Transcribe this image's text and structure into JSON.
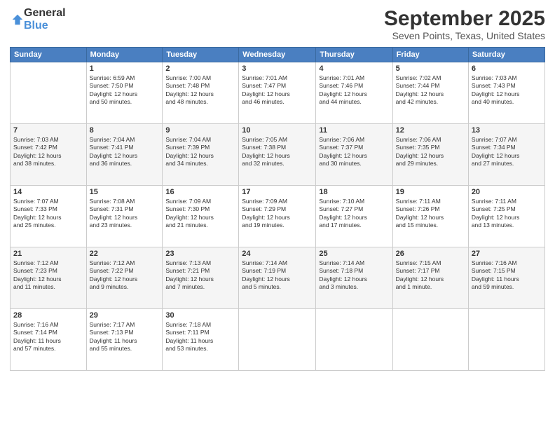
{
  "logo": {
    "general": "General",
    "blue": "Blue"
  },
  "title": "September 2025",
  "subtitle": "Seven Points, Texas, United States",
  "headers": [
    "Sunday",
    "Monday",
    "Tuesday",
    "Wednesday",
    "Thursday",
    "Friday",
    "Saturday"
  ],
  "weeks": [
    [
      {
        "day": "",
        "info": ""
      },
      {
        "day": "1",
        "info": "Sunrise: 6:59 AM\nSunset: 7:50 PM\nDaylight: 12 hours\nand 50 minutes."
      },
      {
        "day": "2",
        "info": "Sunrise: 7:00 AM\nSunset: 7:48 PM\nDaylight: 12 hours\nand 48 minutes."
      },
      {
        "day": "3",
        "info": "Sunrise: 7:01 AM\nSunset: 7:47 PM\nDaylight: 12 hours\nand 46 minutes."
      },
      {
        "day": "4",
        "info": "Sunrise: 7:01 AM\nSunset: 7:46 PM\nDaylight: 12 hours\nand 44 minutes."
      },
      {
        "day": "5",
        "info": "Sunrise: 7:02 AM\nSunset: 7:44 PM\nDaylight: 12 hours\nand 42 minutes."
      },
      {
        "day": "6",
        "info": "Sunrise: 7:03 AM\nSunset: 7:43 PM\nDaylight: 12 hours\nand 40 minutes."
      }
    ],
    [
      {
        "day": "7",
        "info": "Sunrise: 7:03 AM\nSunset: 7:42 PM\nDaylight: 12 hours\nand 38 minutes."
      },
      {
        "day": "8",
        "info": "Sunrise: 7:04 AM\nSunset: 7:41 PM\nDaylight: 12 hours\nand 36 minutes."
      },
      {
        "day": "9",
        "info": "Sunrise: 7:04 AM\nSunset: 7:39 PM\nDaylight: 12 hours\nand 34 minutes."
      },
      {
        "day": "10",
        "info": "Sunrise: 7:05 AM\nSunset: 7:38 PM\nDaylight: 12 hours\nand 32 minutes."
      },
      {
        "day": "11",
        "info": "Sunrise: 7:06 AM\nSunset: 7:37 PM\nDaylight: 12 hours\nand 30 minutes."
      },
      {
        "day": "12",
        "info": "Sunrise: 7:06 AM\nSunset: 7:35 PM\nDaylight: 12 hours\nand 29 minutes."
      },
      {
        "day": "13",
        "info": "Sunrise: 7:07 AM\nSunset: 7:34 PM\nDaylight: 12 hours\nand 27 minutes."
      }
    ],
    [
      {
        "day": "14",
        "info": "Sunrise: 7:07 AM\nSunset: 7:33 PM\nDaylight: 12 hours\nand 25 minutes."
      },
      {
        "day": "15",
        "info": "Sunrise: 7:08 AM\nSunset: 7:31 PM\nDaylight: 12 hours\nand 23 minutes."
      },
      {
        "day": "16",
        "info": "Sunrise: 7:09 AM\nSunset: 7:30 PM\nDaylight: 12 hours\nand 21 minutes."
      },
      {
        "day": "17",
        "info": "Sunrise: 7:09 AM\nSunset: 7:29 PM\nDaylight: 12 hours\nand 19 minutes."
      },
      {
        "day": "18",
        "info": "Sunrise: 7:10 AM\nSunset: 7:27 PM\nDaylight: 12 hours\nand 17 minutes."
      },
      {
        "day": "19",
        "info": "Sunrise: 7:11 AM\nSunset: 7:26 PM\nDaylight: 12 hours\nand 15 minutes."
      },
      {
        "day": "20",
        "info": "Sunrise: 7:11 AM\nSunset: 7:25 PM\nDaylight: 12 hours\nand 13 minutes."
      }
    ],
    [
      {
        "day": "21",
        "info": "Sunrise: 7:12 AM\nSunset: 7:23 PM\nDaylight: 12 hours\nand 11 minutes."
      },
      {
        "day": "22",
        "info": "Sunrise: 7:12 AM\nSunset: 7:22 PM\nDaylight: 12 hours\nand 9 minutes."
      },
      {
        "day": "23",
        "info": "Sunrise: 7:13 AM\nSunset: 7:21 PM\nDaylight: 12 hours\nand 7 minutes."
      },
      {
        "day": "24",
        "info": "Sunrise: 7:14 AM\nSunset: 7:19 PM\nDaylight: 12 hours\nand 5 minutes."
      },
      {
        "day": "25",
        "info": "Sunrise: 7:14 AM\nSunset: 7:18 PM\nDaylight: 12 hours\nand 3 minutes."
      },
      {
        "day": "26",
        "info": "Sunrise: 7:15 AM\nSunset: 7:17 PM\nDaylight: 12 hours\nand 1 minute."
      },
      {
        "day": "27",
        "info": "Sunrise: 7:16 AM\nSunset: 7:15 PM\nDaylight: 11 hours\nand 59 minutes."
      }
    ],
    [
      {
        "day": "28",
        "info": "Sunrise: 7:16 AM\nSunset: 7:14 PM\nDaylight: 11 hours\nand 57 minutes."
      },
      {
        "day": "29",
        "info": "Sunrise: 7:17 AM\nSunset: 7:13 PM\nDaylight: 11 hours\nand 55 minutes."
      },
      {
        "day": "30",
        "info": "Sunrise: 7:18 AM\nSunset: 7:11 PM\nDaylight: 11 hours\nand 53 minutes."
      },
      {
        "day": "",
        "info": ""
      },
      {
        "day": "",
        "info": ""
      },
      {
        "day": "",
        "info": ""
      },
      {
        "day": "",
        "info": ""
      }
    ]
  ]
}
